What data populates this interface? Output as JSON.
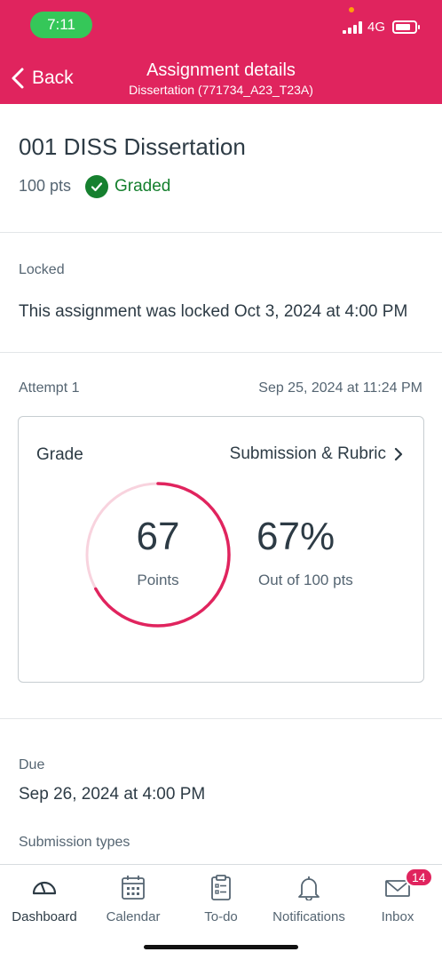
{
  "status_bar": {
    "time": "7:11",
    "network": "4G"
  },
  "header": {
    "back_label": "Back",
    "title": "Assignment details",
    "subtitle": "Dissertation (771734_A23_T23A)",
    "color": "#e0245e"
  },
  "assignment": {
    "title": "001 DISS Dissertation",
    "points": "100 pts",
    "status": "Graded"
  },
  "lock": {
    "label": "Locked",
    "text": "This assignment was locked Oct 3, 2024 at 4:00 PM"
  },
  "attempt": {
    "label": "Attempt 1",
    "date": "Sep 25, 2024 at 11:24 PM"
  },
  "grade_card": {
    "title": "Grade",
    "link_label": "Submission & Rubric",
    "score": "67",
    "score_label": "Points",
    "percent": "67%",
    "percent_value": 0.67,
    "out_of": "Out of 100 pts"
  },
  "due": {
    "label": "Due",
    "value": "Sep 26, 2024 at 4:00 PM"
  },
  "submission_types": {
    "label": "Submission types"
  },
  "tabs": [
    {
      "label": "Dashboard",
      "icon": "dashboard-icon"
    },
    {
      "label": "Calendar",
      "icon": "calendar-icon"
    },
    {
      "label": "To-do",
      "icon": "todo-icon"
    },
    {
      "label": "Notifications",
      "icon": "bell-icon"
    },
    {
      "label": "Inbox",
      "icon": "mail-icon",
      "badge": "14"
    }
  ]
}
